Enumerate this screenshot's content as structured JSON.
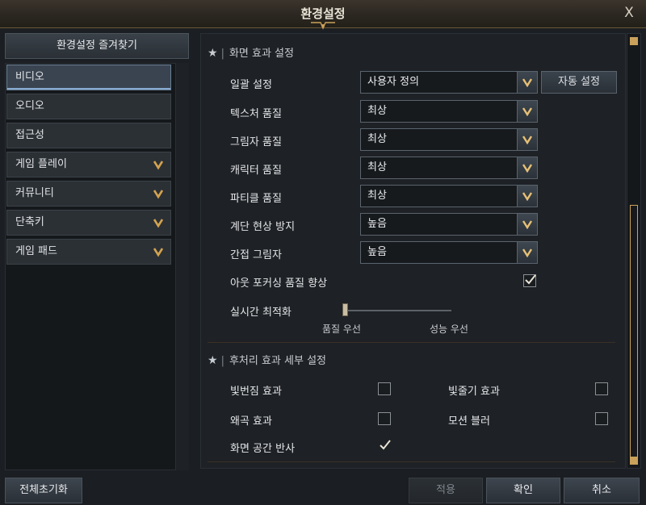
{
  "window": {
    "title": "환경설정",
    "close_label": "X"
  },
  "sidebar": {
    "favorites_label": "환경설정 즐겨찾기",
    "items": [
      {
        "label": "비디오",
        "active": true,
        "expandable": false
      },
      {
        "label": "오디오",
        "active": false,
        "expandable": false
      },
      {
        "label": "접근성",
        "active": false,
        "expandable": false
      },
      {
        "label": "게임 플레이",
        "active": false,
        "expandable": true
      },
      {
        "label": "커뮤니티",
        "active": false,
        "expandable": true
      },
      {
        "label": "단축키",
        "active": false,
        "expandable": true
      },
      {
        "label": "게임 패드",
        "active": false,
        "expandable": true
      }
    ]
  },
  "screen_effects": {
    "title": "화면 효과 설정",
    "preset": {
      "label": "일괄 설정",
      "value": "사용자 정의",
      "auto_button": "자동 설정"
    },
    "settings": [
      {
        "label": "텍스처 품질",
        "value": "최상"
      },
      {
        "label": "그림자 품질",
        "value": "최상"
      },
      {
        "label": "캐릭터 품질",
        "value": "최상"
      },
      {
        "label": "파티클 품질",
        "value": "최상"
      },
      {
        "label": "계단 현상 방지",
        "value": "높음"
      },
      {
        "label": "간접 그림자",
        "value": "높음"
      }
    ],
    "outfocus": {
      "label": "아웃 포커싱 품질 향상",
      "checked": true
    },
    "realtime": {
      "label": "실시간 최적화",
      "min_label": "품질 우선",
      "max_label": "성능 우선",
      "value": 0
    }
  },
  "post_process": {
    "title": "후처리 효과 세부 설정",
    "options": [
      {
        "label": "빛번짐 효과",
        "checked": false
      },
      {
        "label": "빛줄기 효과",
        "checked": false
      },
      {
        "label": "왜곡 효과",
        "checked": false
      },
      {
        "label": "모션 블러",
        "checked": false
      },
      {
        "label": "화면 공간 반사",
        "checked": true
      }
    ]
  },
  "footer": {
    "reset_label": "전체초기화",
    "apply_label": "적용",
    "ok_label": "확인",
    "cancel_label": "취소"
  },
  "colors": {
    "accent": "#c9a15a",
    "active_tab": "#86a9cf"
  },
  "icons": [
    "chevron-down-icon",
    "check-icon",
    "star-icon",
    "close-icon"
  ]
}
